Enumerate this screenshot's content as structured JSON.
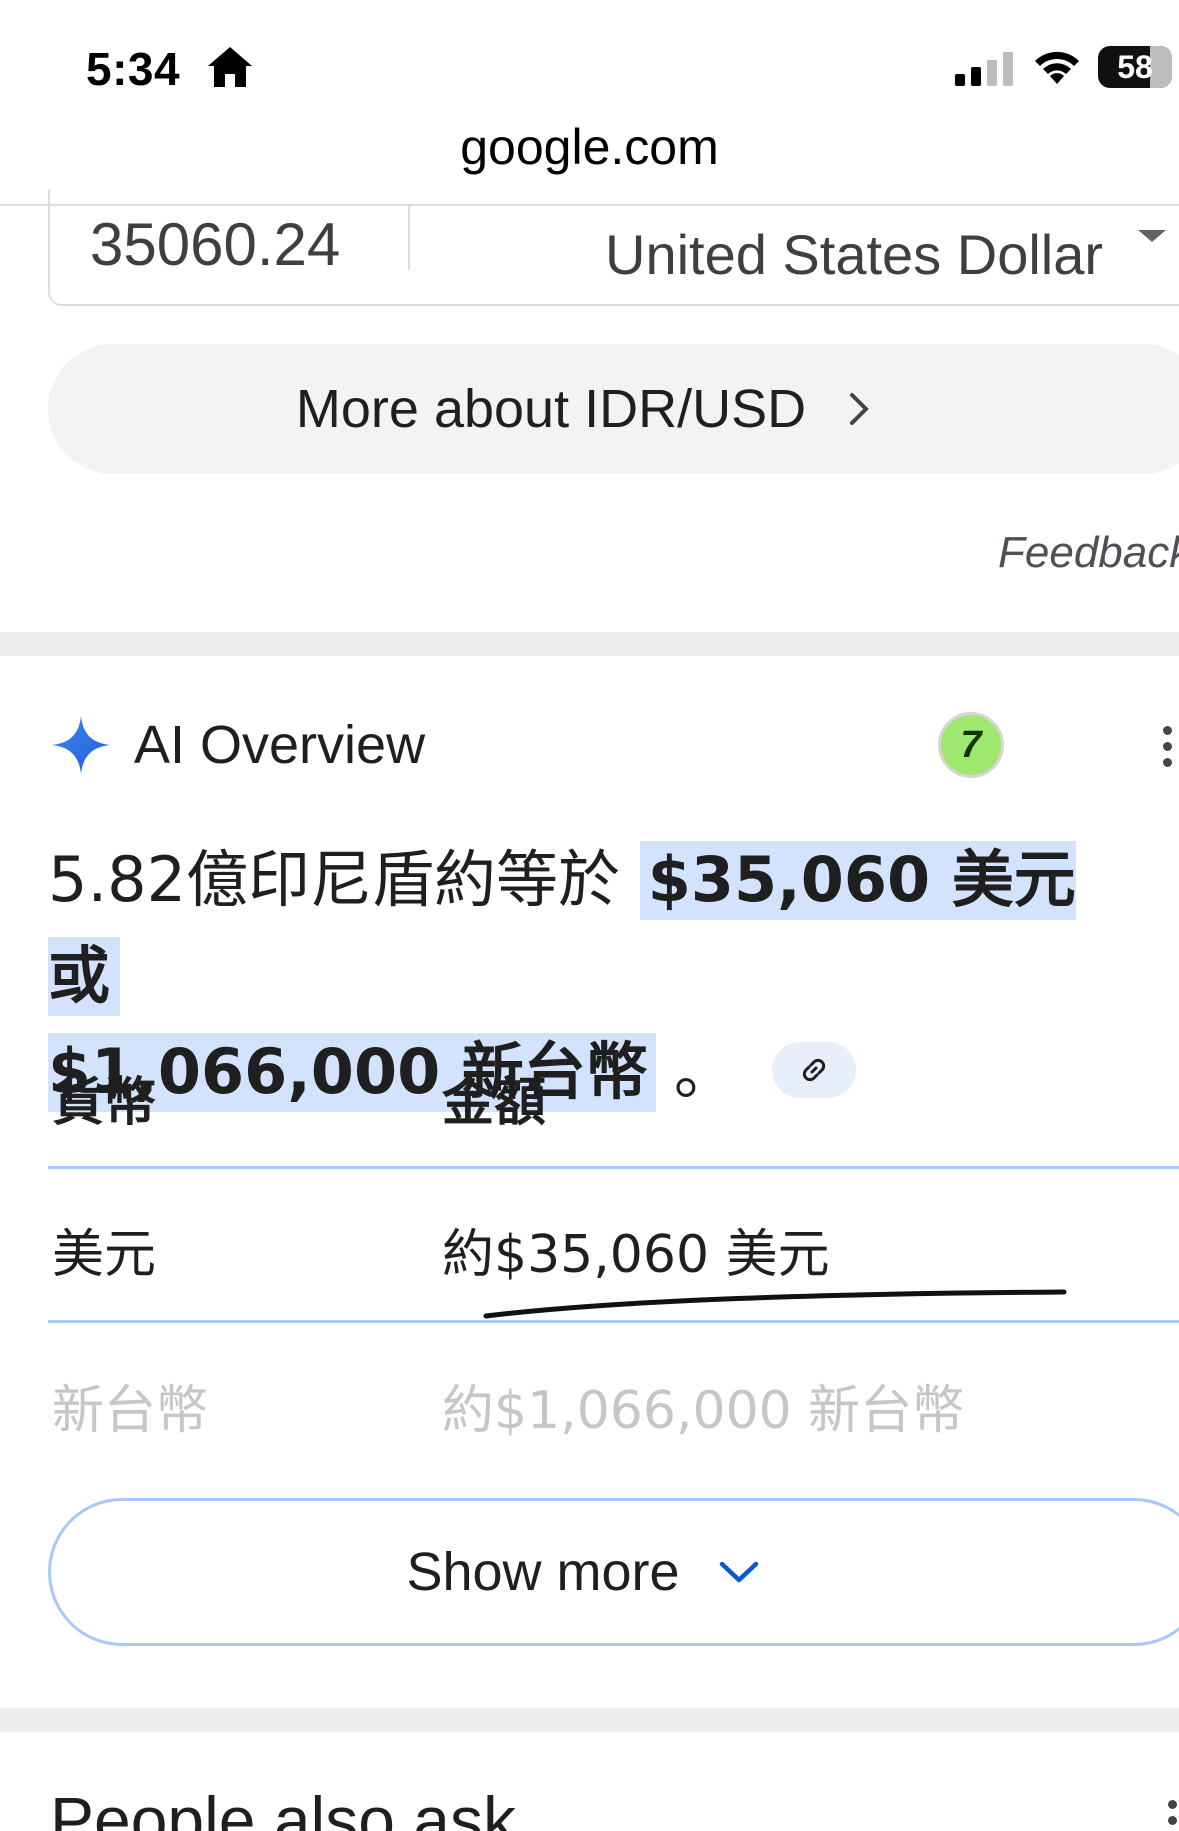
{
  "status_bar": {
    "time": "5:34",
    "battery": "58",
    "icons": [
      "home-icon",
      "signal-icon",
      "wifi-icon",
      "battery-icon"
    ]
  },
  "browser": {
    "url": "google.com"
  },
  "converter": {
    "amount": "35060.24",
    "currency": "United States Dollar"
  },
  "more_about": {
    "label": "More about IDR/USD"
  },
  "feedback": {
    "label": "Feedback"
  },
  "ai_overview": {
    "title": "AI Overview",
    "badge_text": "7",
    "answer_prefix": "5.82億印尼盾約等於 ",
    "answer_highlight_1": "$35,060 美元 或",
    "answer_highlight_2": "$1,066,000 新台幣",
    "answer_suffix": "。",
    "table": {
      "headers": [
        "貨幣",
        "金額"
      ],
      "rows": [
        [
          "美元",
          "約$35,060 美元"
        ],
        [
          "新台幣",
          "約$1,066,000 新台幣"
        ]
      ]
    },
    "show_more": "Show more"
  },
  "people_also_ask": {
    "title": "People also ask"
  },
  "colors": {
    "highlight": "#d3e3fd",
    "accent_blue": "#0b57d0",
    "pill_bg": "#f1f3f4",
    "wise_green": "#9fe870"
  }
}
